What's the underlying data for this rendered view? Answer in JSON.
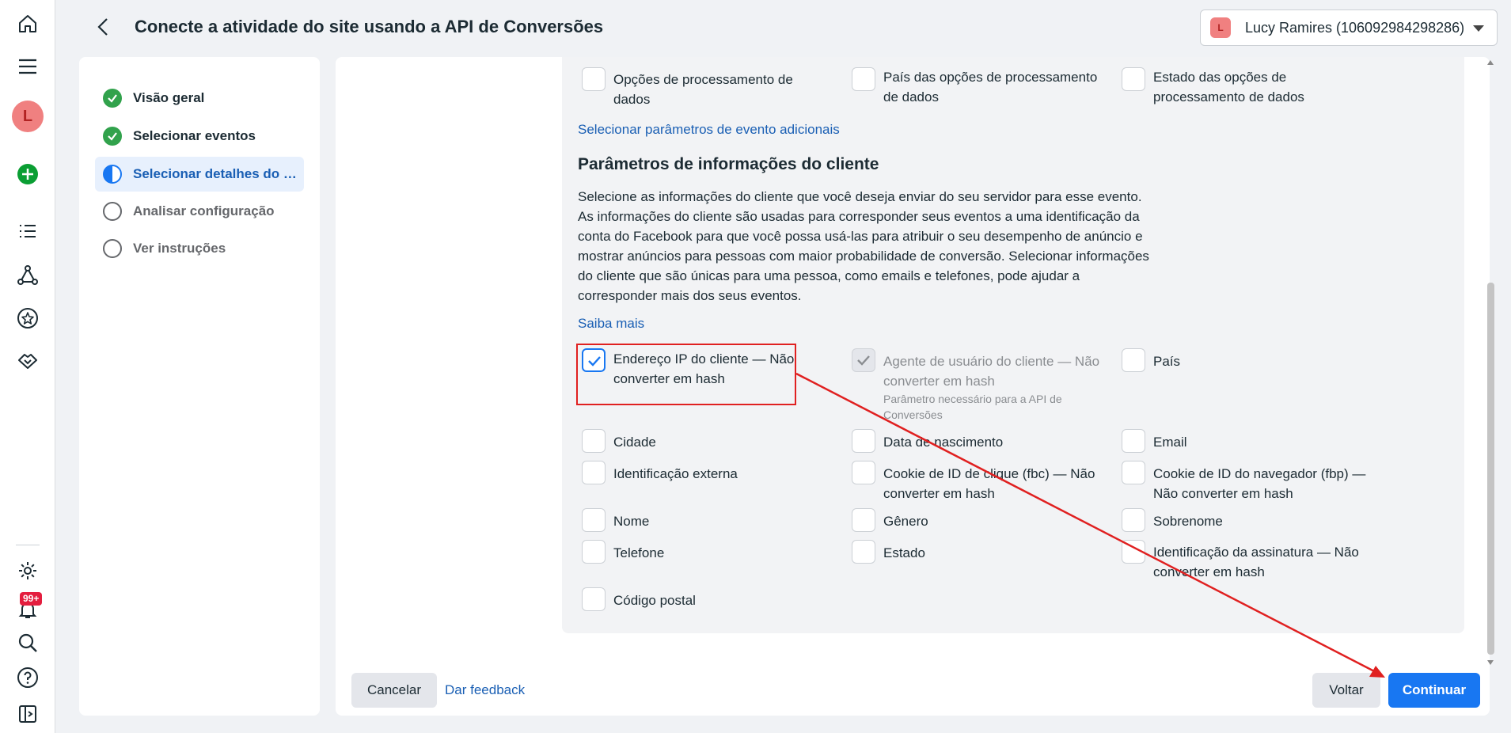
{
  "header": {
    "title": "Conecte a atividade do site usando a API de Conversões",
    "account_initial": "L",
    "account_name": "Lucy Ramires (106092984298286)"
  },
  "rail": {
    "avatar_initial": "L",
    "notification_badge": "99+"
  },
  "steps": [
    {
      "label": "Visão geral",
      "state": "done"
    },
    {
      "label": "Selecionar eventos",
      "state": "done"
    },
    {
      "label": "Selecionar detalhes do evento",
      "state": "current"
    },
    {
      "label": "Analisar configuração",
      "state": "pending"
    },
    {
      "label": "Ver instruções",
      "state": "pending"
    }
  ],
  "event_params": {
    "top_options": [
      {
        "label": "Opções de processamento de dados",
        "checked": false
      },
      {
        "label": "País das opções de processamento de dados",
        "checked": false
      },
      {
        "label": "Estado das opções de processamento de dados",
        "checked": false
      }
    ],
    "more_link": "Selecionar parâmetros de evento adicionais"
  },
  "customer_info": {
    "title": "Parâmetros de informações do cliente",
    "description": "Selecione as informações do cliente que você deseja enviar do seu servidor para esse evento. As informações do cliente são usadas para corresponder seus eventos a uma identificação da conta do Facebook para que você possa usá-las para atribuir o seu desempenho de anúncio e mostrar anúncios para pessoas com maior probabilidade de conversão. Selecionar informações do cliente que são únicas para uma pessoa, como emails e telefones, pode ajudar a corresponder mais dos seus eventos.",
    "learn_more": "Saiba mais",
    "options": [
      {
        "label": "Endereço IP do cliente — Não converter em hash",
        "checked": true
      },
      {
        "label": "Agente de usuário do cliente — Não converter em hash",
        "checked": true,
        "disabled": true,
        "note": "Parâmetro necessário para a API de Conversões"
      },
      {
        "label": "País",
        "checked": false
      },
      {
        "label": "Cidade",
        "checked": false
      },
      {
        "label": "Data de nascimento",
        "checked": false
      },
      {
        "label": "Email",
        "checked": false
      },
      {
        "label": "Identificação externa",
        "checked": false
      },
      {
        "label": "Cookie de ID de clique (fbc) — Não converter em hash",
        "checked": false
      },
      {
        "label": "Cookie de ID do navegador (fbp) — Não converter em hash",
        "checked": false
      },
      {
        "label": "Nome",
        "checked": false
      },
      {
        "label": "Gênero",
        "checked": false
      },
      {
        "label": "Sobrenome",
        "checked": false
      },
      {
        "label": "Telefone",
        "checked": false
      },
      {
        "label": "Estado",
        "checked": false
      },
      {
        "label": "Identificação da assinatura — Não converter em hash",
        "checked": false
      },
      {
        "label": "Código postal",
        "checked": false
      }
    ]
  },
  "footer": {
    "cancel": "Cancelar",
    "feedback": "Dar feedback",
    "back": "Voltar",
    "continue": "Continuar"
  },
  "colors": {
    "accent": "#1877f2",
    "link": "#1a5fb4",
    "annotation": "#e02020",
    "success": "#31a24c"
  }
}
